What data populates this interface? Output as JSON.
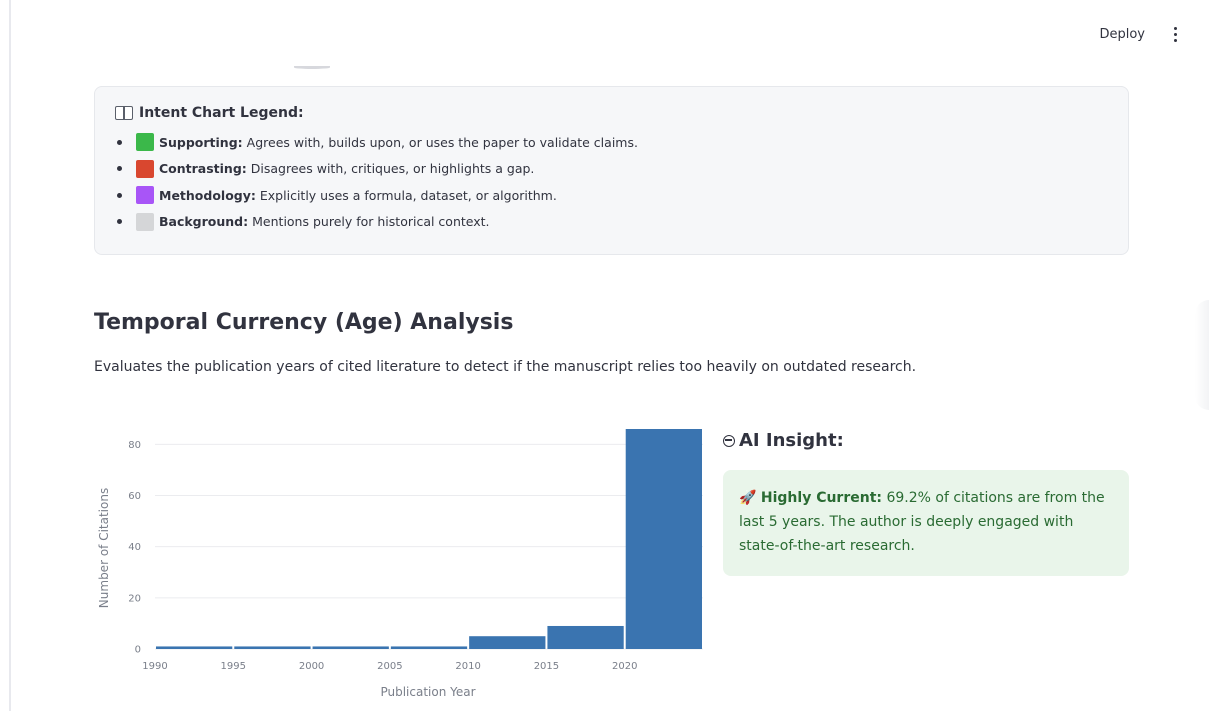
{
  "topbar": {
    "deploy_label": "Deploy"
  },
  "legend": {
    "title": "Intent Chart Legend:",
    "items": [
      {
        "label": "Supporting:",
        "desc": "Agrees with, builds upon, or uses the paper to validate claims.",
        "color": "#3bb84a"
      },
      {
        "label": "Contrasting:",
        "desc": "Disagrees with, critiques, or highlights a gap.",
        "color": "#d9472f"
      },
      {
        "label": "Methodology:",
        "desc": "Explicitly uses a formula, dataset, or algorithm.",
        "color": "#a855f7"
      },
      {
        "label": "Background:",
        "desc": "Mentions purely for historical context.",
        "color": "#d5d6d8"
      }
    ]
  },
  "section": {
    "heading": "Temporal Currency (Age) Analysis",
    "description": "Evaluates the publication years of cited literature to detect if the manuscript relies too heavily on outdated research."
  },
  "chart_data": {
    "type": "bar",
    "bin_edges": [
      1990,
      1995,
      2000,
      2005,
      2010,
      2015,
      2020,
      2025
    ],
    "values": [
      1,
      1,
      1,
      1,
      5,
      9,
      86
    ],
    "xticks": [
      "1990",
      "1995",
      "2000",
      "2005",
      "2010",
      "2015",
      "2020"
    ],
    "yticks": [
      0,
      20,
      40,
      60,
      80
    ],
    "xlabel": "Publication Year",
    "ylabel": "Number of Citations",
    "ylim": [
      0,
      86
    ],
    "grid": true,
    "bar_color": "#3a74b0"
  },
  "insight": {
    "heading": "AI Insight:",
    "strong": "Highly Current:",
    "text": " 69.2% of citations are from the last 5 years. The author is deeply engaged with state-of-the-art research."
  }
}
